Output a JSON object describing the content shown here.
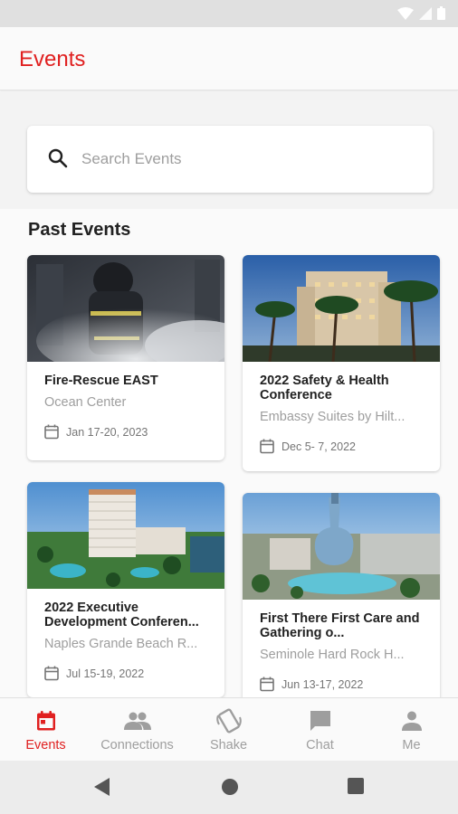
{
  "app": {
    "title": "Events",
    "accent": "#e02020"
  },
  "search": {
    "placeholder": "Search Events"
  },
  "section": {
    "title": "Past Events"
  },
  "events": [
    {
      "title": "Fire-Rescue EAST",
      "venue": "Ocean Center",
      "date": "Jan 17-20, 2023",
      "image": "firefighter-photo"
    },
    {
      "title": "2022 Safety & Health Conference",
      "venue": "Embassy Suites by Hilt...",
      "date": "Dec  5- 7, 2022",
      "image": "hotel-palms-photo"
    },
    {
      "title": "2022 Executive Development Conferen...",
      "venue": "Naples Grande Beach R...",
      "date": "Jul 15-19, 2022",
      "image": "beach-resort-photo"
    },
    {
      "title": "First There First Care and Gathering o...",
      "venue": "Seminole Hard Rock H...",
      "date": "Jun 13-17, 2022",
      "image": "guitar-hotel-photo"
    }
  ],
  "bottom_nav": [
    {
      "label": "Events",
      "icon": "calendar-icon",
      "active": true
    },
    {
      "label": "Connections",
      "icon": "people-icon",
      "active": false
    },
    {
      "label": "Shake",
      "icon": "shake-phone-icon",
      "active": false
    },
    {
      "label": "Chat",
      "icon": "chat-bubble-icon",
      "active": false
    },
    {
      "label": "Me",
      "icon": "person-icon",
      "active": false
    }
  ]
}
